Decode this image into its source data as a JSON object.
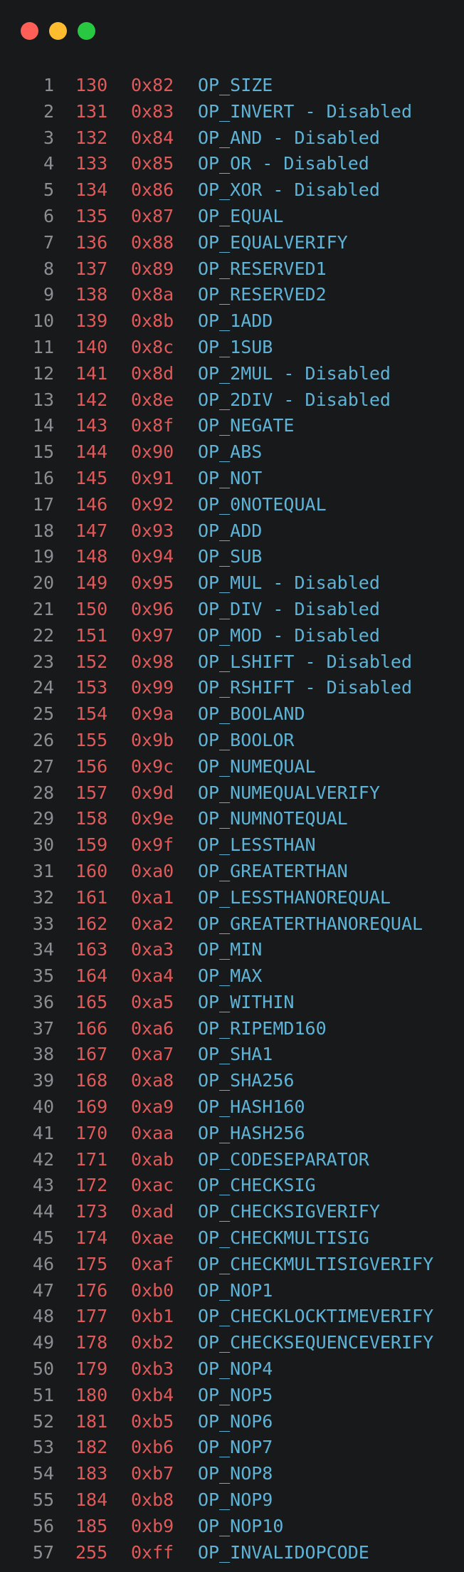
{
  "window": {
    "controls": [
      "close",
      "minimize",
      "zoom"
    ],
    "colors": {
      "background": "#17191b",
      "line_number": "#8b8f93",
      "opcode_number": "#e05a5a",
      "opcode_name": "#5fb3d6",
      "close": "#ff5f57",
      "minimize": "#febc2e",
      "zoom": "#28c840"
    }
  },
  "lines": [
    {
      "n": "1",
      "dec": "130",
      "hex": "0x82",
      "name": "OP_SIZE"
    },
    {
      "n": "2",
      "dec": "131",
      "hex": "0x83",
      "name": "OP_INVERT - Disabled"
    },
    {
      "n": "3",
      "dec": "132",
      "hex": "0x84",
      "name": "OP_AND - Disabled"
    },
    {
      "n": "4",
      "dec": "133",
      "hex": "0x85",
      "name": "OP_OR - Disabled"
    },
    {
      "n": "5",
      "dec": "134",
      "hex": "0x86",
      "name": "OP_XOR - Disabled"
    },
    {
      "n": "6",
      "dec": "135",
      "hex": "0x87",
      "name": "OP_EQUAL"
    },
    {
      "n": "7",
      "dec": "136",
      "hex": "0x88",
      "name": "OP_EQUALVERIFY"
    },
    {
      "n": "8",
      "dec": "137",
      "hex": "0x89",
      "name": "OP_RESERVED1"
    },
    {
      "n": "9",
      "dec": "138",
      "hex": "0x8a",
      "name": "OP_RESERVED2"
    },
    {
      "n": "10",
      "dec": "139",
      "hex": "0x8b",
      "name": "OP_1ADD"
    },
    {
      "n": "11",
      "dec": "140",
      "hex": "0x8c",
      "name": "OP_1SUB"
    },
    {
      "n": "12",
      "dec": "141",
      "hex": "0x8d",
      "name": "OP_2MUL - Disabled"
    },
    {
      "n": "13",
      "dec": "142",
      "hex": "0x8e",
      "name": "OP_2DIV - Disabled"
    },
    {
      "n": "14",
      "dec": "143",
      "hex": "0x8f",
      "name": "OP_NEGATE"
    },
    {
      "n": "15",
      "dec": "144",
      "hex": "0x90",
      "name": "OP_ABS"
    },
    {
      "n": "16",
      "dec": "145",
      "hex": "0x91",
      "name": "OP_NOT"
    },
    {
      "n": "17",
      "dec": "146",
      "hex": "0x92",
      "name": "OP_0NOTEQUAL"
    },
    {
      "n": "18",
      "dec": "147",
      "hex": "0x93",
      "name": "OP_ADD"
    },
    {
      "n": "19",
      "dec": "148",
      "hex": "0x94",
      "name": "OP_SUB"
    },
    {
      "n": "20",
      "dec": "149",
      "hex": "0x95",
      "name": "OP_MUL - Disabled"
    },
    {
      "n": "21",
      "dec": "150",
      "hex": "0x96",
      "name": "OP_DIV - Disabled"
    },
    {
      "n": "22",
      "dec": "151",
      "hex": "0x97",
      "name": "OP_MOD - Disabled"
    },
    {
      "n": "23",
      "dec": "152",
      "hex": "0x98",
      "name": "OP_LSHIFT - Disabled"
    },
    {
      "n": "24",
      "dec": "153",
      "hex": "0x99",
      "name": "OP_RSHIFT - Disabled"
    },
    {
      "n": "25",
      "dec": "154",
      "hex": "0x9a",
      "name": "OP_BOOLAND"
    },
    {
      "n": "26",
      "dec": "155",
      "hex": "0x9b",
      "name": "OP_BOOLOR"
    },
    {
      "n": "27",
      "dec": "156",
      "hex": "0x9c",
      "name": "OP_NUMEQUAL"
    },
    {
      "n": "28",
      "dec": "157",
      "hex": "0x9d",
      "name": "OP_NUMEQUALVERIFY"
    },
    {
      "n": "29",
      "dec": "158",
      "hex": "0x9e",
      "name": "OP_NUMNOTEQUAL"
    },
    {
      "n": "30",
      "dec": "159",
      "hex": "0x9f",
      "name": "OP_LESSTHAN"
    },
    {
      "n": "31",
      "dec": "160",
      "hex": "0xa0",
      "name": "OP_GREATERTHAN"
    },
    {
      "n": "32",
      "dec": "161",
      "hex": "0xa1",
      "name": "OP_LESSTHANOREQUAL"
    },
    {
      "n": "33",
      "dec": "162",
      "hex": "0xa2",
      "name": "OP_GREATERTHANOREQUAL"
    },
    {
      "n": "34",
      "dec": "163",
      "hex": "0xa3",
      "name": "OP_MIN"
    },
    {
      "n": "35",
      "dec": "164",
      "hex": "0xa4",
      "name": "OP_MAX"
    },
    {
      "n": "36",
      "dec": "165",
      "hex": "0xa5",
      "name": "OP_WITHIN"
    },
    {
      "n": "37",
      "dec": "166",
      "hex": "0xa6",
      "name": "OP_RIPEMD160"
    },
    {
      "n": "38",
      "dec": "167",
      "hex": "0xa7",
      "name": "OP_SHA1"
    },
    {
      "n": "39",
      "dec": "168",
      "hex": "0xa8",
      "name": "OP_SHA256"
    },
    {
      "n": "40",
      "dec": "169",
      "hex": "0xa9",
      "name": "OP_HASH160"
    },
    {
      "n": "41",
      "dec": "170",
      "hex": "0xaa",
      "name": "OP_HASH256"
    },
    {
      "n": "42",
      "dec": "171",
      "hex": "0xab",
      "name": "OP_CODESEPARATOR"
    },
    {
      "n": "43",
      "dec": "172",
      "hex": "0xac",
      "name": "OP_CHECKSIG"
    },
    {
      "n": "44",
      "dec": "173",
      "hex": "0xad",
      "name": "OP_CHECKSIGVERIFY"
    },
    {
      "n": "45",
      "dec": "174",
      "hex": "0xae",
      "name": "OP_CHECKMULTISIG"
    },
    {
      "n": "46",
      "dec": "175",
      "hex": "0xaf",
      "name": "OP_CHECKMULTISIGVERIFY"
    },
    {
      "n": "47",
      "dec": "176",
      "hex": "0xb0",
      "name": "OP_NOP1"
    },
    {
      "n": "48",
      "dec": "177",
      "hex": "0xb1",
      "name": "OP_CHECKLOCKTIMEVERIFY"
    },
    {
      "n": "49",
      "dec": "178",
      "hex": "0xb2",
      "name": "OP_CHECKSEQUENCEVERIFY"
    },
    {
      "n": "50",
      "dec": "179",
      "hex": "0xb3",
      "name": "OP_NOP4"
    },
    {
      "n": "51",
      "dec": "180",
      "hex": "0xb4",
      "name": "OP_NOP5"
    },
    {
      "n": "52",
      "dec": "181",
      "hex": "0xb5",
      "name": "OP_NOP6"
    },
    {
      "n": "53",
      "dec": "182",
      "hex": "0xb6",
      "name": "OP_NOP7"
    },
    {
      "n": "54",
      "dec": "183",
      "hex": "0xb7",
      "name": "OP_NOP8"
    },
    {
      "n": "55",
      "dec": "184",
      "hex": "0xb8",
      "name": "OP_NOP9"
    },
    {
      "n": "56",
      "dec": "185",
      "hex": "0xb9",
      "name": "OP_NOP10"
    },
    {
      "n": "57",
      "dec": "255",
      "hex": "0xff",
      "name": "OP_INVALIDOPCODE"
    }
  ]
}
